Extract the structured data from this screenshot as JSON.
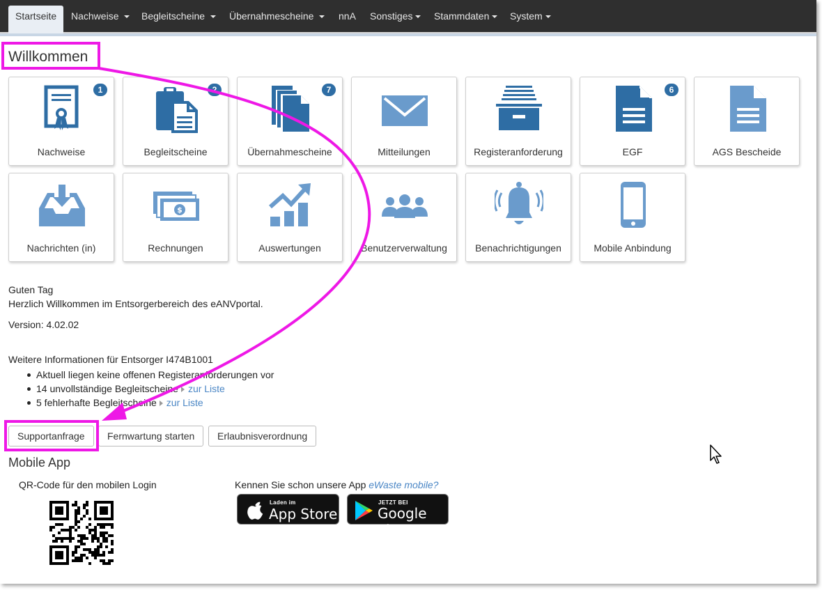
{
  "nav": {
    "items": [
      {
        "label": "Startseite",
        "active": true
      },
      {
        "label": "Nachweise ",
        "caret": true
      },
      {
        "label": "Begleitscheine ",
        "caret": true
      },
      {
        "label": "Übernahmescheine ",
        "caret": true
      },
      {
        "label": "nnA"
      },
      {
        "label": "Sonstiges",
        "caret": true
      },
      {
        "label": "Stammdaten",
        "caret": true
      },
      {
        "label": "System",
        "caret": true
      }
    ]
  },
  "page": {
    "title": "Willkommen"
  },
  "tiles": [
    {
      "label": "Nachweise",
      "icon": "certificate-icon",
      "badge": "1"
    },
    {
      "label": "Begleitscheine",
      "icon": "clipboard-document-icon",
      "badge": "2"
    },
    {
      "label": "Übernahmescheine",
      "icon": "stacked-documents-icon",
      "badge": "7"
    },
    {
      "label": "Mitteilungen",
      "icon": "envelope-icon"
    },
    {
      "label": "Registeranforderung",
      "icon": "file-drawer-icon"
    },
    {
      "label": "EGF",
      "icon": "document-lines-icon",
      "badge": "6"
    },
    {
      "label": "AGS Bescheide",
      "icon": "document-lines-light-icon"
    },
    {
      "label": "Nachrichten (in)",
      "icon": "inbox-download-icon"
    },
    {
      "label": "Rechnungen",
      "icon": "money-bills-icon"
    },
    {
      "label": "Auswertungen",
      "icon": "growth-chart-icon"
    },
    {
      "label": "Benutzerverwaltung",
      "icon": "users-group-icon"
    },
    {
      "label": "Benachrichtigungen",
      "icon": "bell-icon"
    },
    {
      "label": "Mobile Anbindung",
      "icon": "mobile-phone-icon"
    }
  ],
  "welcome": {
    "greeting": "Guten Tag",
    "message": "Herzlich Willkommen im Entsorgerbereich des eANVportal.",
    "version": "Version: 4.02.02"
  },
  "info": {
    "heading": "Weitere Informationen für Entsorger I474B1001",
    "items": [
      {
        "text": "Aktuell liegen keine offenen Registeranforderungen vor"
      },
      {
        "text": "14 unvollständige Begleitscheine",
        "link": "zur Liste"
      },
      {
        "text": "5 fehlerhafte Begleitscheine",
        "link": "zur Liste"
      }
    ]
  },
  "buttons": {
    "support": "Supportanfrage",
    "remote": "Fernwartung starten",
    "permit": "Erlaubnisverordnung"
  },
  "mobile": {
    "heading": "Mobile App",
    "qr_label": "QR-Code für den mobilen Login",
    "promo_prefix": "Kennen Sie schon unsere App ",
    "promo_app": "eWaste mobile?",
    "appstore_small": "Laden im",
    "appstore_big": "App Store",
    "googleplay_small": "JETZT BEI",
    "googleplay_big": "Google Play"
  },
  "colors": {
    "icon_blue": "#2e6da4",
    "icon_light_blue": "#6a9bcc",
    "highlight_magenta": "#ee18e6",
    "navbar": "#2f2f2f",
    "link": "#4a86c5"
  }
}
